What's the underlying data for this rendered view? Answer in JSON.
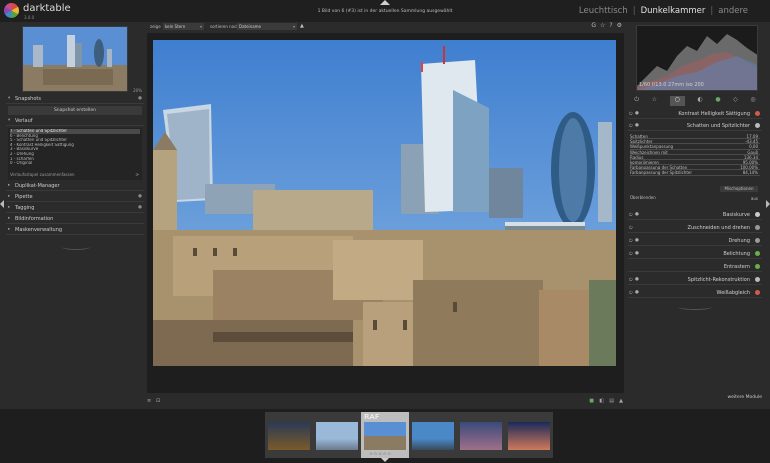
{
  "app": {
    "name": "darktable",
    "version": "3.0.0"
  },
  "header": {
    "status": "1 Bild von 6 (#3) ist in der aktuellen Sammlung ausgewählt",
    "views": [
      "Leuchttisch",
      "Dunkelkammer",
      "andere"
    ],
    "active_view": "Dunkelkammer"
  },
  "left_panel": {
    "navigation": {
      "zoom": "20%"
    },
    "snapshots": {
      "title": "Snapshots",
      "button": "Snapshot erstellen"
    },
    "history": {
      "title": "Verlauf",
      "items": [
        "7 - Schatten und Spitzlichter",
        "6 - Belichtung",
        "5 - Schatten und Spitzlichter",
        "4 - Kontrast Helligkeit Sättigung",
        "3 - Basiskurve",
        "2 - Drehung",
        "1 - schärfen",
        "0 - Original"
      ],
      "compress": "Verlaufsstapel zusammenfassen"
    },
    "sections": [
      "Duplikat-Manager",
      "Pipette",
      "Tagging",
      "Bildinformation",
      "Maskenverwaltung"
    ]
  },
  "center_toolbar": {
    "label_show": "zeige",
    "filter_value": "kein Stern",
    "label_sort": "sortieren nach",
    "sort_value": "Dateiname"
  },
  "histogram": {
    "info": "1/60 f/13.0 27mm iso 200"
  },
  "right_panel": {
    "modules": [
      {
        "name": "Kontrast Helligkeit Sättigung",
        "icon_color": "#d45a4a"
      },
      {
        "name": "Schatten und Spitzlichter",
        "icon_color": "#bbbbbb"
      },
      {
        "name": "Basiskurve",
        "icon_color": "#cccccc"
      },
      {
        "name": "Zuschneiden und drehen",
        "icon_color": "#999999"
      },
      {
        "name": "Drehung",
        "icon_color": "#999999"
      },
      {
        "name": "Belichtung",
        "icon_color": "#6ab04a"
      },
      {
        "name": "Entrastern",
        "icon_color": "#6ab04a"
      },
      {
        "name": "Spitzlicht-Rekonstruktion",
        "icon_color": "#bbbbbb"
      },
      {
        "name": "Weißabgleich",
        "icon_color": "#d45a4a"
      }
    ],
    "shadows_params": [
      {
        "label": "Schatten",
        "value": "17,09"
      },
      {
        "label": "Spitzlichter",
        "value": "-43,45"
      },
      {
        "label": "Weißpunktanpassung",
        "value": "0,00"
      },
      {
        "label": "Weichzeichnen mit",
        "value": "Gauß"
      },
      {
        "label": "Radius",
        "value": "136,34"
      },
      {
        "label": "kompriimieren",
        "value": "95,00%"
      },
      {
        "label": "Farbanpassung der Schatten",
        "value": "100,00%"
      },
      {
        "label": "Farbanpassung der Spitzlichter",
        "value": "84,14%"
      }
    ],
    "mix_label": "Mischoptionen",
    "blend": {
      "label": "Überblenden",
      "value": "aus"
    },
    "more_modules": "weitere Module"
  },
  "filmstrip": {
    "selected_ext": "RAF",
    "stars": "☆☆☆☆☆"
  }
}
